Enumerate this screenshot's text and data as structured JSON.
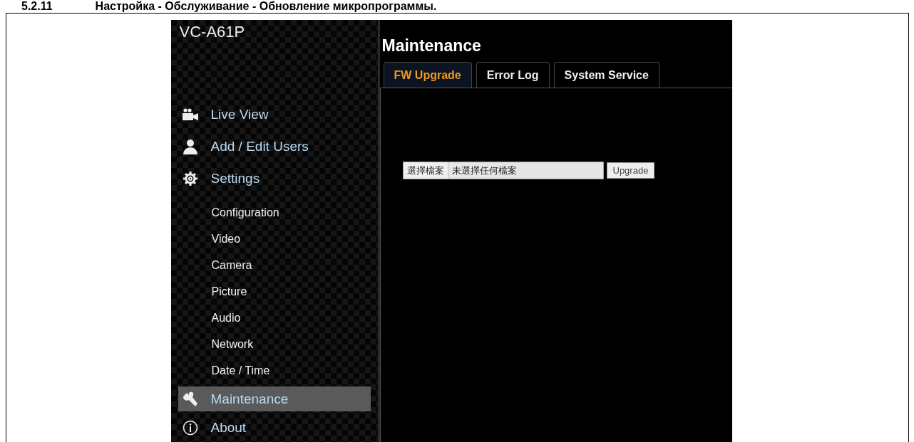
{
  "document_heading": {
    "number": "5.2.11",
    "title": "Настройка - Обслуживание - Обновление микропрограммы."
  },
  "app": {
    "title": "VC-A61P",
    "nav": [
      {
        "label": "Live View",
        "kind": "main",
        "selected": false
      },
      {
        "label": "Add / Edit Users",
        "kind": "main",
        "selected": false
      },
      {
        "label": "Settings",
        "kind": "main",
        "selected": false
      },
      {
        "label": "Configuration",
        "kind": "sub",
        "selected": false
      },
      {
        "label": "Video",
        "kind": "sub",
        "selected": false
      },
      {
        "label": "Camera",
        "kind": "sub",
        "selected": false
      },
      {
        "label": "Picture",
        "kind": "sub",
        "selected": false
      },
      {
        "label": "Audio",
        "kind": "sub",
        "selected": false
      },
      {
        "label": "Network",
        "kind": "sub",
        "selected": false
      },
      {
        "label": "Date / Time",
        "kind": "sub",
        "selected": false
      },
      {
        "label": "Maintenance",
        "kind": "main",
        "selected": true
      },
      {
        "label": "About",
        "kind": "main",
        "selected": false
      }
    ],
    "page_title": "Maintenance",
    "tabs": [
      {
        "label": "FW Upgrade",
        "selected": true
      },
      {
        "label": "Error Log",
        "selected": false
      },
      {
        "label": "System Service",
        "selected": false
      }
    ],
    "file_input": {
      "button": "選擇檔案",
      "status": "未選擇任何檔案"
    },
    "upgrade_button": "Upgrade"
  }
}
